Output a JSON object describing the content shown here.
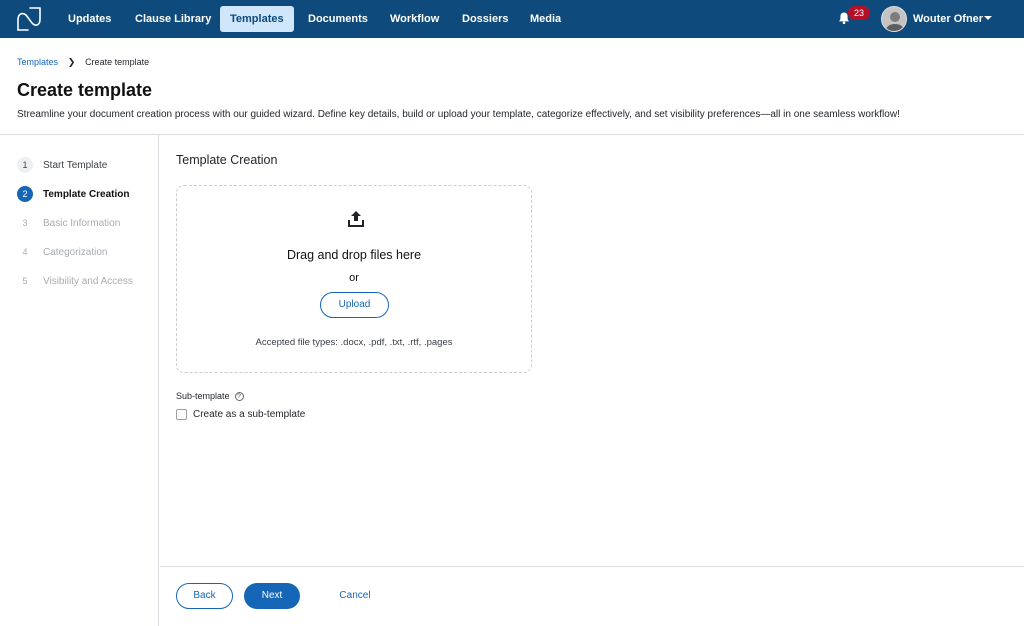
{
  "nav": {
    "items": [
      {
        "label": "Updates",
        "active": false
      },
      {
        "label": "Clause Library",
        "active": false
      },
      {
        "label": "Templates",
        "active": true
      },
      {
        "label": "Documents",
        "active": false
      },
      {
        "label": "Workflow",
        "active": false
      },
      {
        "label": "Dossiers",
        "active": false
      },
      {
        "label": "Media",
        "active": false
      }
    ],
    "notification_count": "23",
    "user_name": "Wouter Ofner"
  },
  "breadcrumb": {
    "parent": "Templates",
    "current": "Create template"
  },
  "page": {
    "title": "Create template",
    "description": "Streamline your document creation process with our guided wizard. Define key details, build or upload your template, categorize effectively, and set visibility preferences—all in one seamless workflow!"
  },
  "steps": [
    {
      "num": "1",
      "label": "Start Template",
      "state": "done"
    },
    {
      "num": "2",
      "label": "Template Creation",
      "state": "current"
    },
    {
      "num": "3",
      "label": "Basic Information",
      "state": "todo"
    },
    {
      "num": "4",
      "label": "Categorization",
      "state": "todo"
    },
    {
      "num": "5",
      "label": "Visibility and Access",
      "state": "todo"
    }
  ],
  "main": {
    "section_title": "Template Creation",
    "dropzone": {
      "title": "Drag and drop files here",
      "or": "or",
      "upload_label": "Upload",
      "accepted": "Accepted file types: .docx, .pdf, .txt, .rtf, .pages"
    },
    "subtemplate": {
      "label": "Sub-template",
      "checkbox_label": "Create as a sub-template",
      "checked": false
    }
  },
  "footer": {
    "back_label": "Back",
    "next_label": "Next",
    "cancel_label": "Cancel"
  },
  "colors": {
    "topbar": "#0f4a7c",
    "active_nav": "#cfe6fb",
    "accent": "#1566b7",
    "badge": "#b3112a"
  }
}
